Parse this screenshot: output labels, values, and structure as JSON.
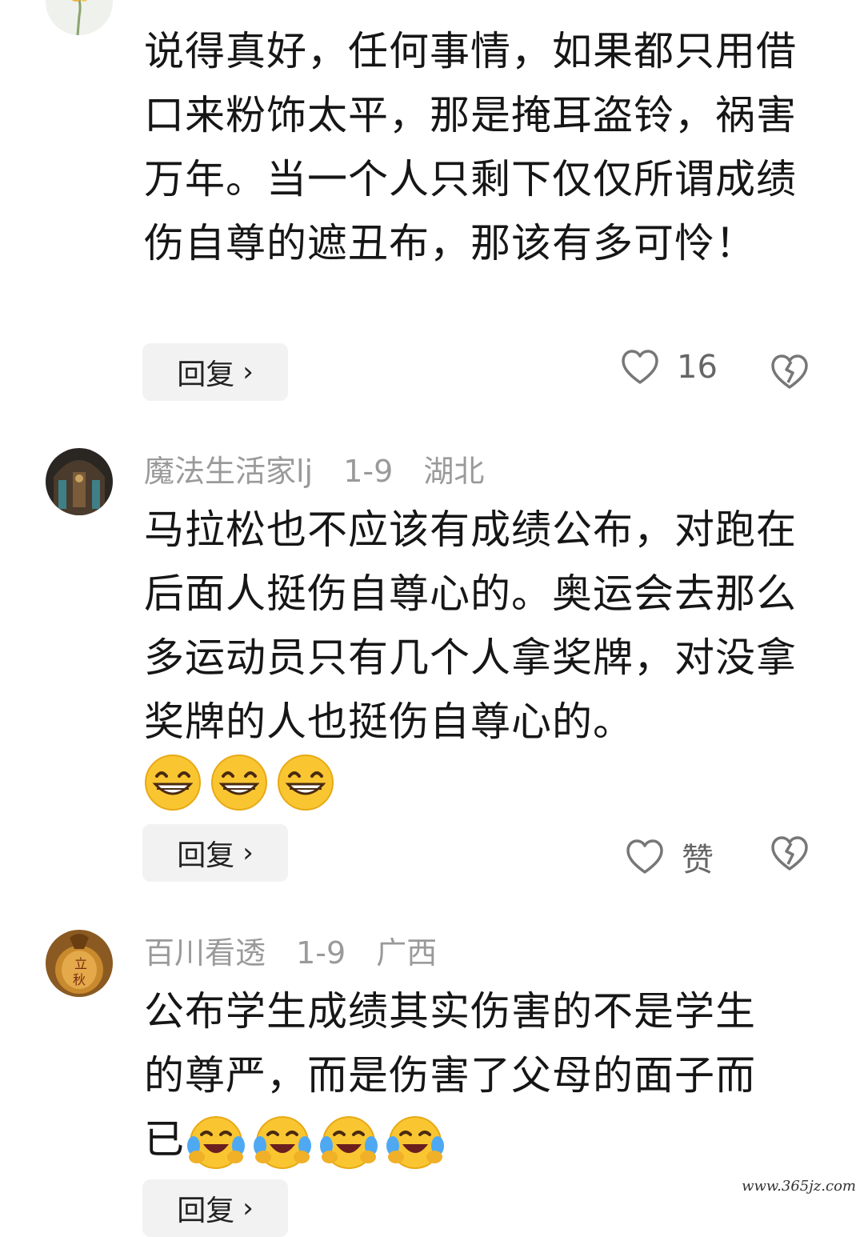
{
  "comments": [
    {
      "username": "",
      "date": "",
      "location": "",
      "text": "说得真好，任何事情，如果都只用借口来粉饰太平，那是掩耳盗铃，祸害万年。当一个人只剩下仅仅所谓成绩伤自尊的遮丑布，那该有多可怜！",
      "reply_label": "回复",
      "like_label": "16"
    },
    {
      "username": "魔法生活家lj",
      "date": "1-9",
      "location": "湖北",
      "text": "马拉松也不应该有成绩公布，对跑在后面人挺伤自尊心的。奥运会去那么多运动员只有几个人拿奖牌，对没拿奖牌的人也挺伤自尊心的。",
      "reply_label": "回复",
      "like_label": "赞"
    },
    {
      "username": "百川看透",
      "date": "1-9",
      "location": "广西",
      "text": "公布学生成绩其实伤害的不是学生的尊严，而是伤害了父母的面子而已",
      "reply_label": "回复",
      "like_label": ""
    }
  ],
  "watermark": "www.365jz.com",
  "icons": {
    "like": "heart-outline-icon",
    "dislike": "broken-heart-icon",
    "grin": "grinning-emoji",
    "laugh": "laugh-crying-emoji"
  }
}
